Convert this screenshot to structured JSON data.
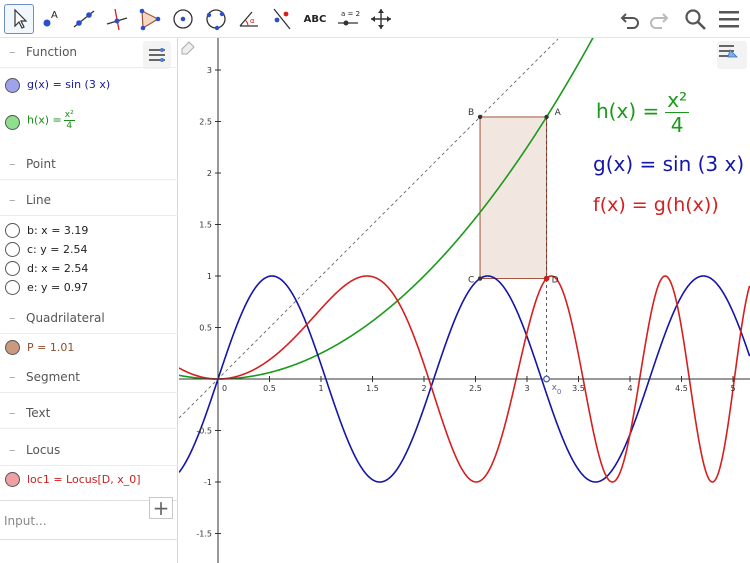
{
  "toolbar": {
    "tools": [
      {
        "name": "move-tool",
        "icon": "cursor-arrow-icon",
        "active": true
      },
      {
        "name": "point-tool",
        "icon": "point-A-icon"
      },
      {
        "name": "line-tool",
        "icon": "line-through-two-points-icon"
      },
      {
        "name": "perpendicular-line-tool",
        "icon": "perpendicular-line-icon"
      },
      {
        "name": "polygon-tool",
        "icon": "polygon-icon"
      },
      {
        "name": "circle-tool",
        "icon": "circle-with-center-icon"
      },
      {
        "name": "circle-three-points-tool",
        "icon": "circle-three-points-icon"
      },
      {
        "name": "angle-tool",
        "icon": "angle-icon"
      },
      {
        "name": "reflect-tool",
        "icon": "reflect-about-line-icon"
      },
      {
        "name": "text-tool",
        "icon": "text-icon",
        "label": "ABC"
      },
      {
        "name": "slider-tool",
        "icon": "slider-icon",
        "label": "a = 2"
      },
      {
        "name": "move-graphics-tool",
        "icon": "move-arrows-icon"
      }
    ],
    "right": [
      "undo-icon",
      "redo-icon",
      "search-icon",
      "menu-icon"
    ]
  },
  "algebra": {
    "categories": {
      "function": "Function",
      "point": "Point",
      "line": "Line",
      "quadrilateral": "Quadrilateral",
      "segment": "Segment",
      "text": "Text",
      "locus": "Locus"
    },
    "functions": [
      {
        "text": "g(x)  =  sin (3 x)",
        "color": "#1515a8",
        "marble": "#9fa3ee"
      },
      {
        "text": "h(x)  =",
        "num": "x²",
        "den": "4",
        "color": "#1a8f1a",
        "marble": "#8ede8e"
      }
    ],
    "lines": [
      "b: x = 3.19",
      "c: y = 2.54",
      "d: x = 2.54",
      "e: y = 0.97"
    ],
    "quadrilateral": {
      "text": "P = 1.01",
      "color": "#8a4d2a",
      "marble": "#c99a80"
    },
    "locus": {
      "text": "loc1 = Locus[D, x_0]",
      "color": "#cc2020",
      "marble": "#f0a0a0"
    },
    "input_placeholder": "Input..."
  },
  "graphics": {
    "x_ticks": [
      "0",
      "0.5",
      "1",
      "1.5",
      "2",
      "2.5",
      "3",
      "3.5",
      "4",
      "4.5",
      "5"
    ],
    "y_ticks": [
      "3",
      "2.5",
      "2",
      "1.5",
      "1",
      "0.5",
      "-0.5",
      "-1",
      "-1.5"
    ],
    "point_labels": [
      "A",
      "B",
      "C",
      "D"
    ],
    "slider_label": "x",
    "slider_sub": "0",
    "formulas": {
      "h_lhs": "h(x)  =",
      "h_num": "x²",
      "h_den": "4",
      "g": "g(x)  =  sin (3 x)",
      "f": "f(x) = g(h(x))"
    },
    "colors": {
      "g": "#1515a8",
      "h": "#1a9a1a",
      "f": "#d42020",
      "rect_fill": "#f2e6e0",
      "rect_stroke": "#a0553a"
    }
  }
}
